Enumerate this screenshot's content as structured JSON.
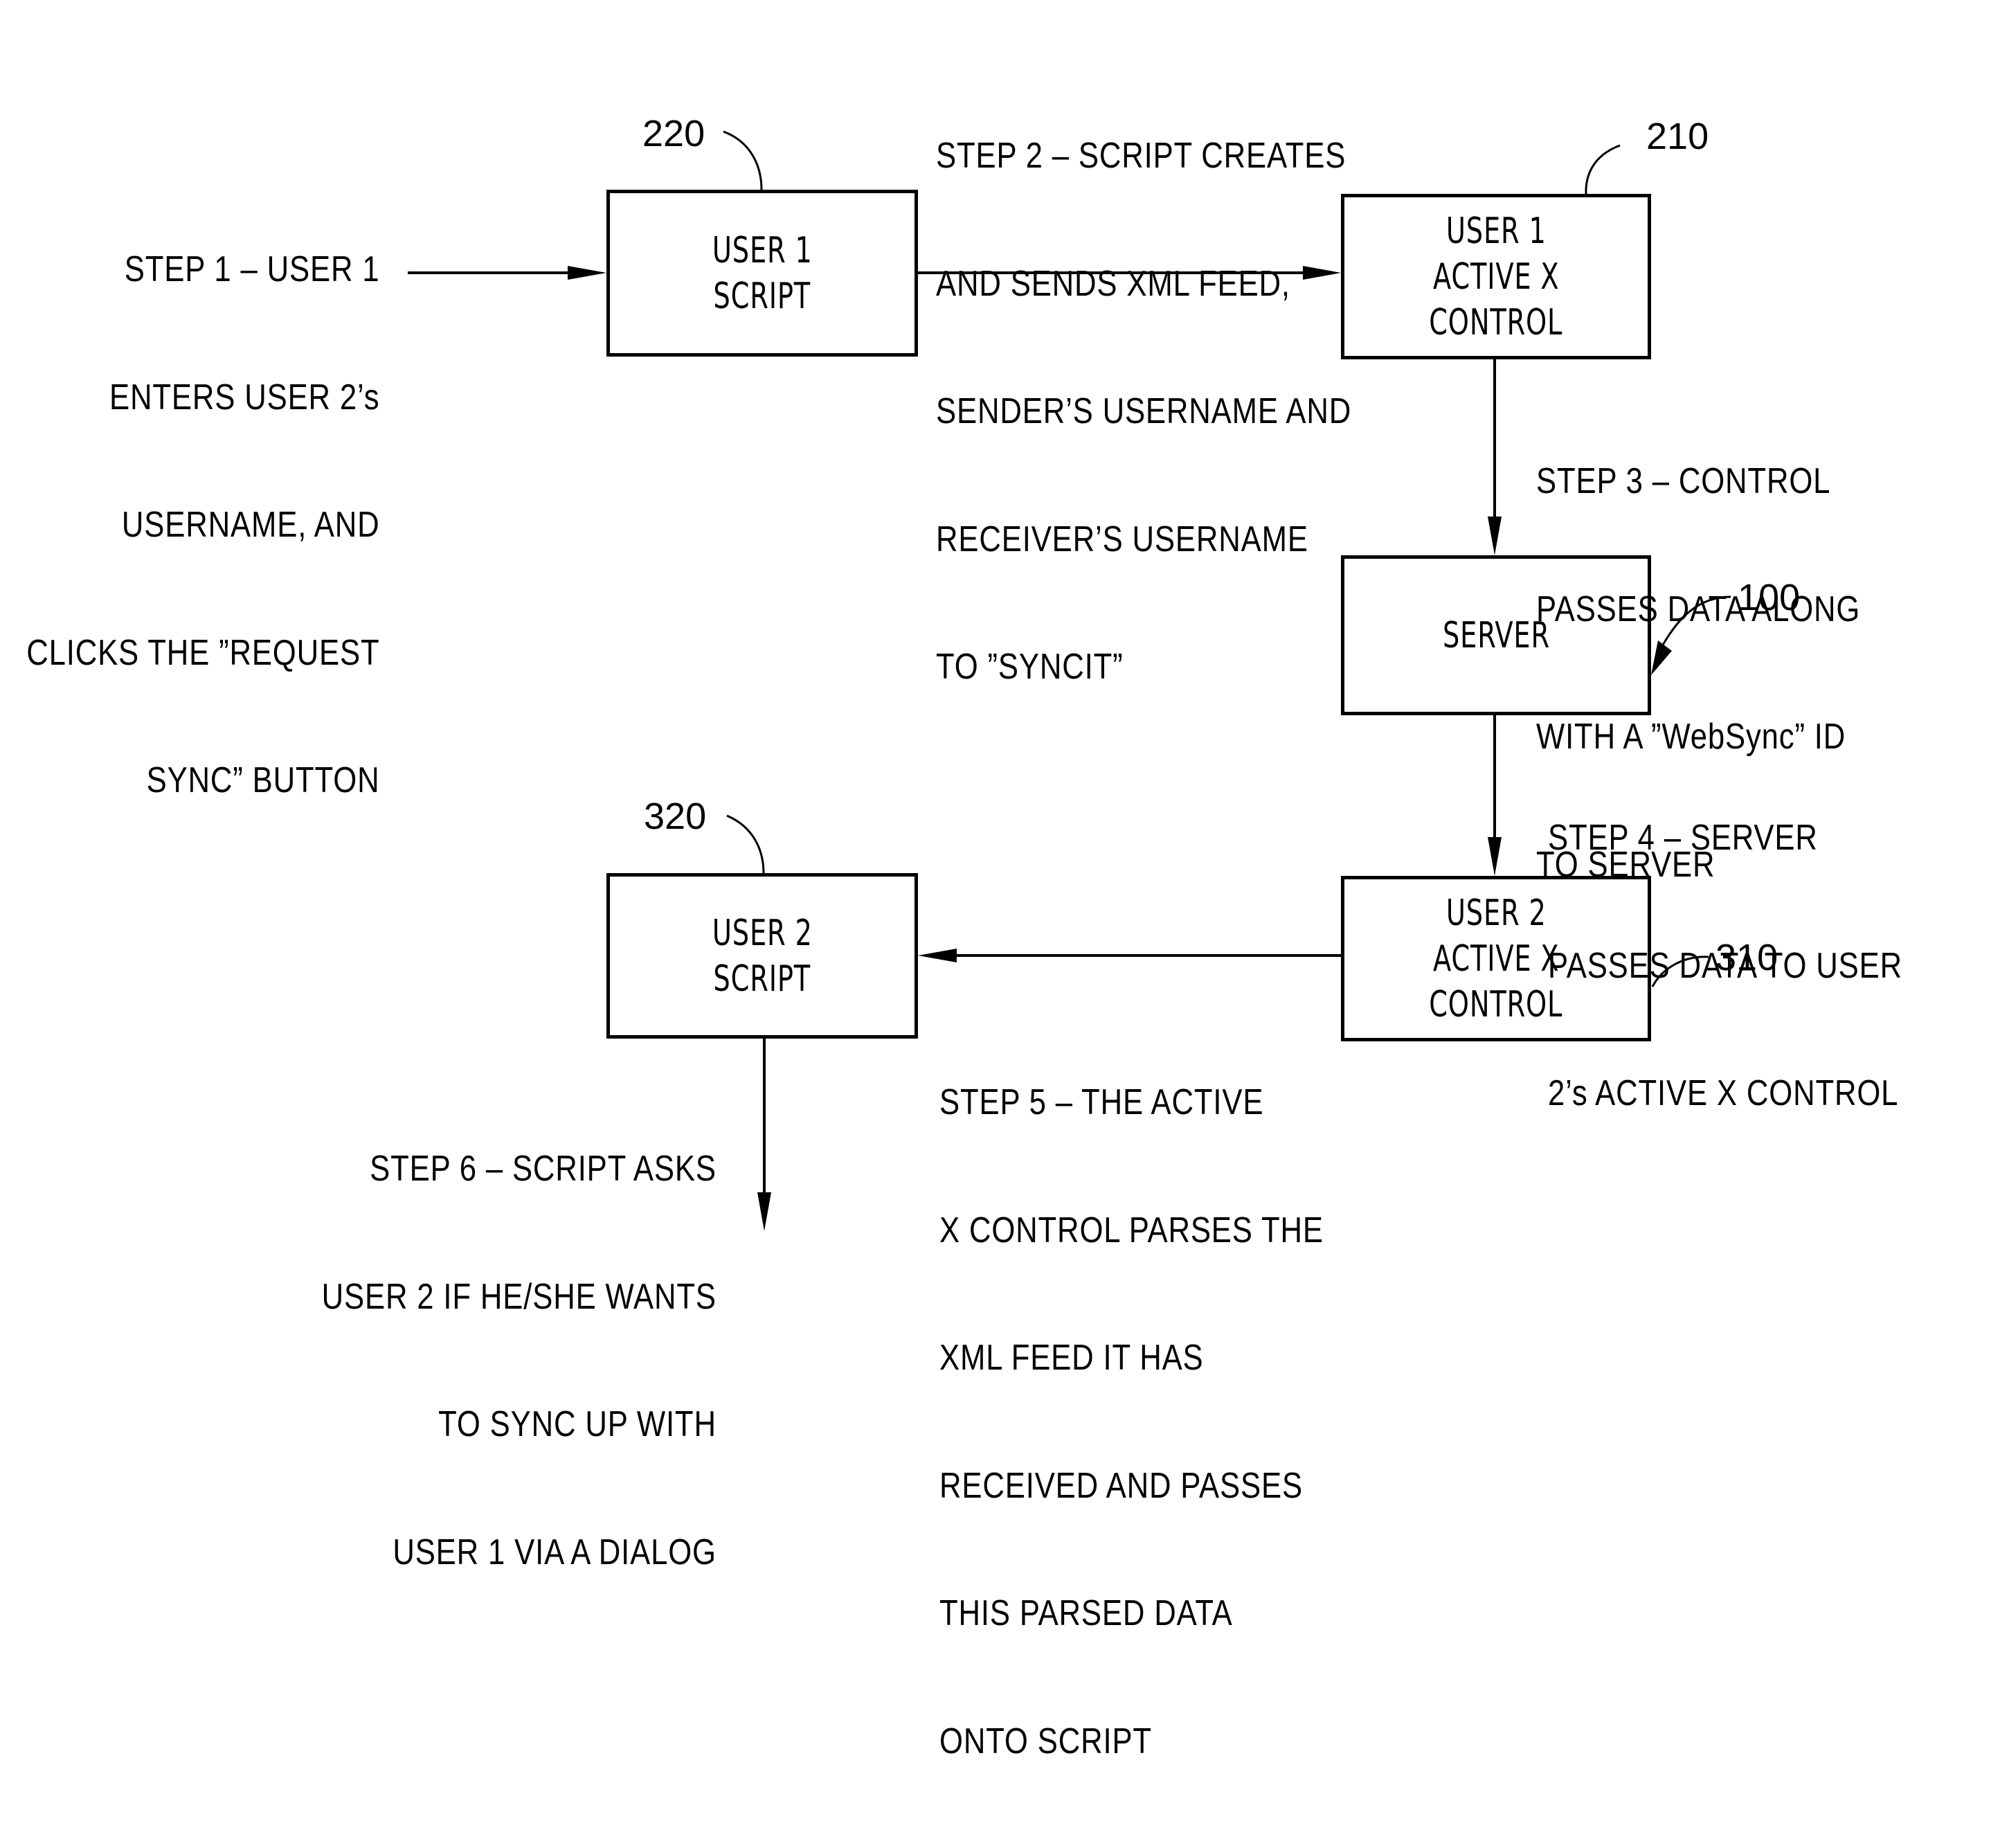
{
  "diagram": {
    "type": "flowchart",
    "nodes": [
      {
        "id": "220",
        "lines": [
          "USER 1",
          "SCRIPT"
        ]
      },
      {
        "id": "210",
        "lines": [
          "USER 1",
          "ACTIVE X",
          "CONTROL"
        ]
      },
      {
        "id": "100",
        "lines": [
          "SERVER"
        ]
      },
      {
        "id": "310",
        "lines": [
          "USER 2",
          "ACTIVE X",
          "CONTROL"
        ]
      },
      {
        "id": "320",
        "lines": [
          "USER 2",
          "SCRIPT"
        ]
      }
    ],
    "ref_labels": {
      "user1_script": "220",
      "user1_activex": "210",
      "server": "100",
      "user2_activex": "310",
      "user2_script": "320"
    },
    "steps": [
      {
        "name": "step-1",
        "lines": [
          "STEP 1 – USER 1",
          "ENTERS USER 2’s",
          "USERNAME, AND",
          "CLICKS THE ”REQUEST",
          "SYNC” BUTTON"
        ]
      },
      {
        "name": "step-2",
        "lines": [
          "STEP 2 – SCRIPT CREATES",
          "AND SENDS XML FEED,",
          "SENDER’S USERNAME AND",
          "RECEIVER’S USERNAME",
          "TO ”SYNCIT”"
        ]
      },
      {
        "name": "step-3",
        "lines": [
          "STEP 3 – CONTROL",
          "PASSES DATA ALONG",
          "WITH A ”WebSync” ID",
          "TO SERVER"
        ]
      },
      {
        "name": "step-4",
        "lines": [
          "STEP 4 – SERVER",
          "PASSES DATA TO USER",
          "2’s ACTIVE X CONTROL"
        ]
      },
      {
        "name": "step-5",
        "lines": [
          "STEP 5 – THE ACTIVE",
          "X CONTROL PARSES THE",
          "XML FEED IT HAS",
          "RECEIVED AND PASSES",
          "THIS PARSED DATA",
          "ONTO SCRIPT"
        ]
      },
      {
        "name": "step-6",
        "lines": [
          "STEP 6 – SCRIPT ASKS",
          "USER 2 IF HE/SHE WANTS",
          "TO SYNC UP WITH",
          "USER 1 VIA A DIALOG"
        ]
      }
    ],
    "edges": [
      {
        "from": "user-input",
        "to": "220",
        "step": 1
      },
      {
        "from": "220",
        "to": "210",
        "step": 2
      },
      {
        "from": "210",
        "to": "100",
        "step": 3
      },
      {
        "from": "100",
        "to": "310",
        "step": 4
      },
      {
        "from": "310",
        "to": "320",
        "step": 5
      },
      {
        "from": "320",
        "to": "dialog",
        "step": 6
      }
    ]
  }
}
